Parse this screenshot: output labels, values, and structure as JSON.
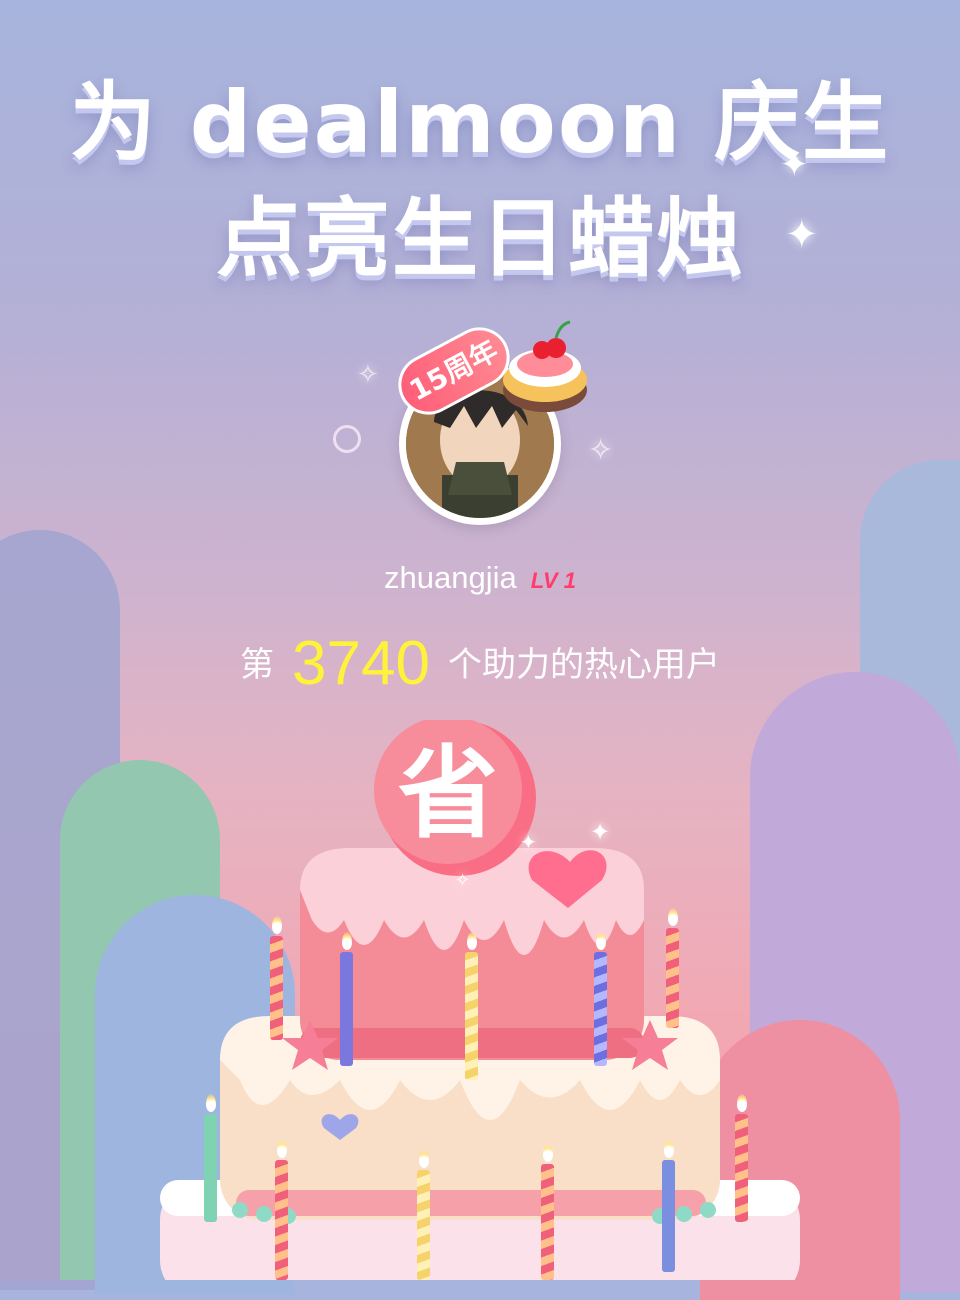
{
  "header": {
    "title_line1": "为 dealmoon 庆生",
    "title_line2": "点亮生日蜡烛"
  },
  "profile": {
    "badge": "15周年",
    "username": "zhuangjia",
    "level": "LV 1"
  },
  "stats": {
    "prefix": "第",
    "count": "3740",
    "suffix": "个助力的热心用户"
  },
  "cake": {
    "topper": "省"
  },
  "colors": {
    "count_highlight": "#fff23a",
    "level_badge": "#ff3c6a",
    "accent_pink": "#f37a8c"
  },
  "icons": [
    "sparkle-icon",
    "cherry-cake-icon",
    "heart-icon",
    "star-icon",
    "candle-icon"
  ]
}
